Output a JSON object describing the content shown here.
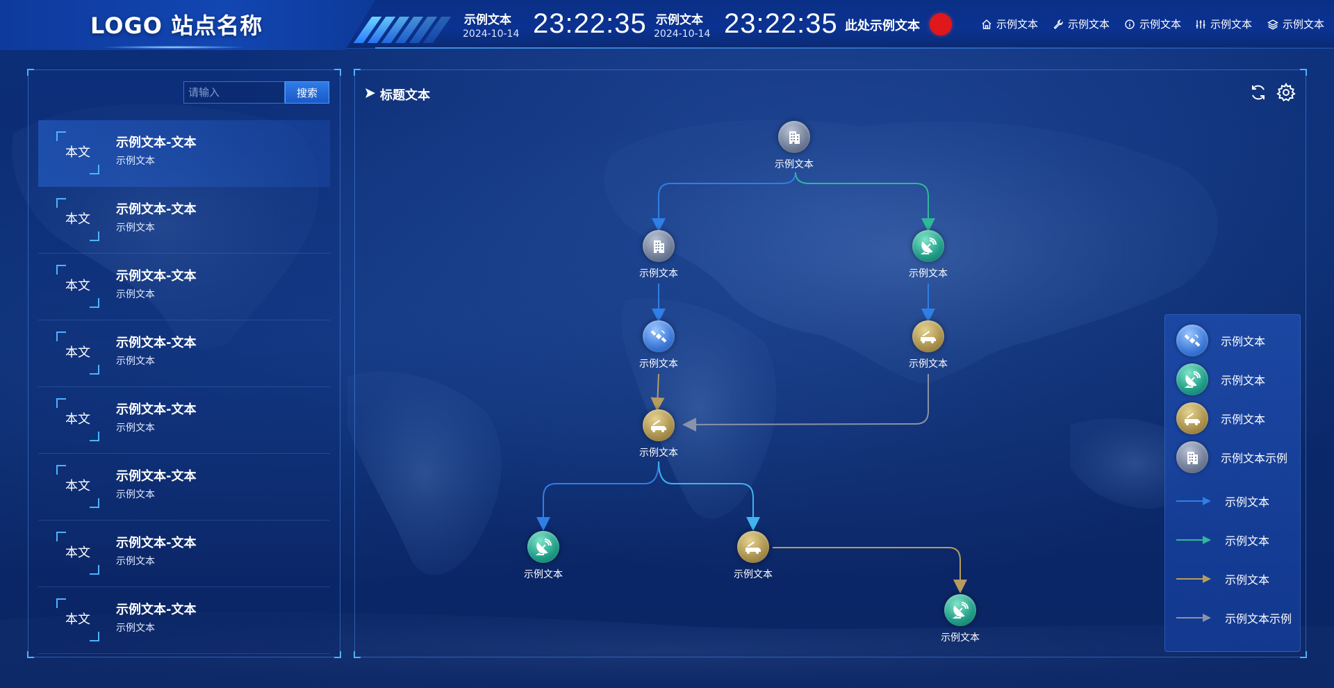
{
  "header": {
    "site_title": "LOGO 站点名称",
    "clocks": [
      {
        "label": "示例文本",
        "date": "2024-10-14",
        "time": "23:22:35"
      },
      {
        "label": "示例文本",
        "date": "2024-10-14",
        "time": "23:22:35"
      }
    ],
    "notice": "此处示例文本",
    "status_color": "#e0171b",
    "nav": [
      {
        "icon": "home-icon",
        "label": "示例文本"
      },
      {
        "icon": "wrench-icon",
        "label": "示例文本"
      },
      {
        "icon": "info-icon",
        "label": "示例文本"
      },
      {
        "icon": "sliders-icon",
        "label": "示例文本"
      },
      {
        "icon": "layers-icon",
        "label": "示例文本"
      }
    ]
  },
  "sidebar": {
    "search": {
      "placeholder": "请输入",
      "value": "",
      "button_label": "搜索"
    },
    "items": [
      {
        "badge": "本文",
        "title": "示例文本-文本",
        "subtitle": "示例文本",
        "active": true
      },
      {
        "badge": "本文",
        "title": "示例文本-文本",
        "subtitle": "示例文本"
      },
      {
        "badge": "本文",
        "title": "示例文本-文本",
        "subtitle": "示例文本"
      },
      {
        "badge": "本文",
        "title": "示例文本-文本",
        "subtitle": "示例文本"
      },
      {
        "badge": "本文",
        "title": "示例文本-文本",
        "subtitle": "示例文本"
      },
      {
        "badge": "本文",
        "title": "示例文本-文本",
        "subtitle": "示例文本"
      },
      {
        "badge": "本文",
        "title": "示例文本-文本",
        "subtitle": "示例文本"
      },
      {
        "badge": "本文",
        "title": "示例文本-文本",
        "subtitle": "示例文本"
      }
    ]
  },
  "main": {
    "title": "标题文本",
    "tools": [
      {
        "icon": "refresh-icon"
      },
      {
        "icon": "gear-icon"
      }
    ]
  },
  "flow": {
    "nodes": [
      {
        "id": "n1",
        "type": "building",
        "label": "示例文本"
      },
      {
        "id": "n2",
        "type": "building",
        "label": "示例文本"
      },
      {
        "id": "n3",
        "type": "dish",
        "label": "示例文本"
      },
      {
        "id": "n4",
        "type": "satellite",
        "label": "示例文本"
      },
      {
        "id": "n5",
        "type": "truck",
        "label": "示例文本"
      },
      {
        "id": "n6",
        "type": "truck",
        "label": "示例文本"
      },
      {
        "id": "n7",
        "type": "dish",
        "label": "示例文本"
      },
      {
        "id": "n8",
        "type": "truck",
        "label": "示例文本"
      },
      {
        "id": "n9",
        "type": "dish",
        "label": "示例文本"
      }
    ],
    "edges": [
      {
        "from": "n1",
        "to": "n2",
        "color": "blue"
      },
      {
        "from": "n1",
        "to": "n3",
        "color": "green"
      },
      {
        "from": "n2",
        "to": "n4",
        "color": "blue"
      },
      {
        "from": "n3",
        "to": "n5",
        "color": "blue"
      },
      {
        "from": "n4",
        "to": "n6",
        "color": "gold"
      },
      {
        "from": "n5",
        "to": "n6",
        "color": "gray"
      },
      {
        "from": "n6",
        "to": "n7",
        "color": "blue"
      },
      {
        "from": "n6",
        "to": "n8",
        "color": "cyan"
      },
      {
        "from": "n8",
        "to": "n9",
        "color": "gold"
      }
    ]
  },
  "legend": {
    "items": [
      {
        "kind": "icon",
        "type": "satellite",
        "label": "示例文本"
      },
      {
        "kind": "icon",
        "type": "dish",
        "label": "示例文本"
      },
      {
        "kind": "icon",
        "type": "truck",
        "label": "示例文本"
      },
      {
        "kind": "icon",
        "type": "building",
        "label": "示例文本示例"
      },
      {
        "kind": "arrow",
        "color": "#2f7fe6",
        "label": "示例文本"
      },
      {
        "kind": "arrow",
        "color": "#2fb89a",
        "label": "示例文本"
      },
      {
        "kind": "arrow",
        "color": "#b59d5f",
        "label": "示例文本"
      },
      {
        "kind": "arrow",
        "color": "#8a93a8",
        "label": "示例文本示例"
      }
    ]
  },
  "colors": {
    "blue": "#2f7fe6",
    "cyan": "#3fb4f0",
    "green": "#2fb89a",
    "gold": "#b59d5f",
    "gray": "#8a93a8",
    "accent": "#4fb3ff"
  }
}
